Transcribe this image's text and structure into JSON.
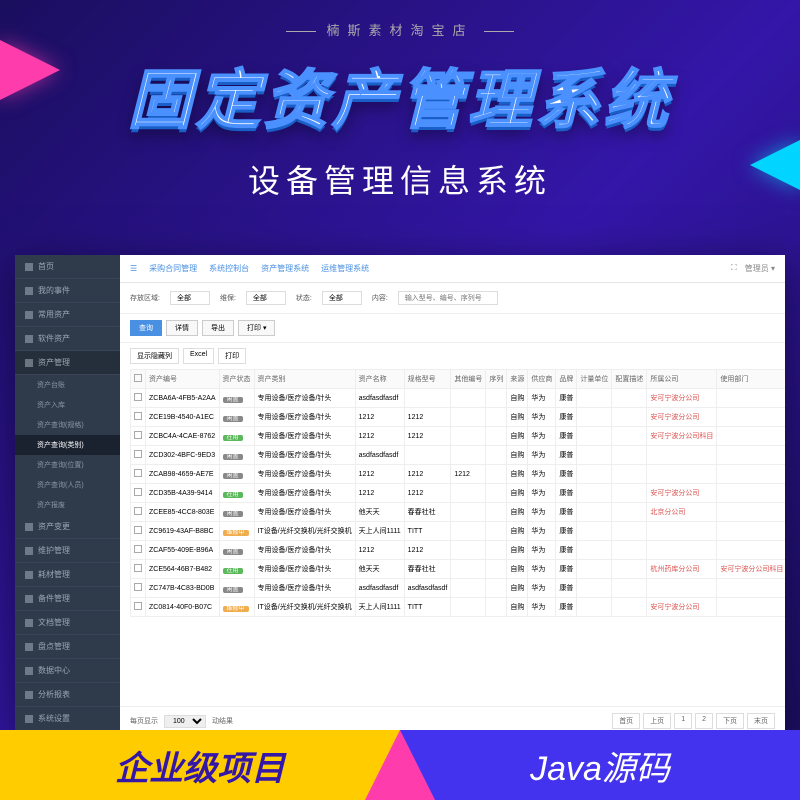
{
  "banner": {
    "tagline": "楠斯素材淘宝店",
    "title": "固定资产管理系统",
    "subtitle": "设备管理信息系统"
  },
  "footer": {
    "left": "企业级项目",
    "right": "Java源码"
  },
  "sidebar": {
    "items": [
      {
        "icon": "home",
        "label": "首页",
        "sub": []
      },
      {
        "icon": "user",
        "label": "我的事件",
        "sub": []
      },
      {
        "icon": "cube",
        "label": "常用资产",
        "sub": []
      },
      {
        "icon": "soft",
        "label": "软件资产",
        "sub": []
      },
      {
        "icon": "asset",
        "label": "资产管理",
        "expanded": true,
        "sub": [
          {
            "label": "资产台账"
          },
          {
            "label": "资产入库"
          },
          {
            "label": "资产查询(规格)"
          },
          {
            "label": "资产查询(类别)",
            "active": true
          },
          {
            "label": "资产查询(位置)"
          },
          {
            "label": "资产查询(人员)"
          },
          {
            "label": "资产报废"
          }
        ]
      },
      {
        "icon": "change",
        "label": "资产变更",
        "sub": []
      },
      {
        "icon": "maint",
        "label": "维护管理",
        "sub": []
      },
      {
        "icon": "mat",
        "label": "耗材管理",
        "sub": []
      },
      {
        "icon": "spare",
        "label": "备件管理",
        "sub": []
      },
      {
        "icon": "doc",
        "label": "文档管理",
        "sub": []
      },
      {
        "icon": "inv",
        "label": "盘点管理",
        "sub": []
      },
      {
        "icon": "data",
        "label": "数据中心",
        "sub": []
      },
      {
        "icon": "report",
        "label": "分析报表",
        "sub": []
      },
      {
        "icon": "sys",
        "label": "系统设置",
        "sub": []
      }
    ]
  },
  "topnav": {
    "items": [
      "采购合同管理",
      "系统控制台",
      "资产管理系统",
      "运维管理系统"
    ],
    "right": {
      "user": "管理员"
    }
  },
  "filters": {
    "area_label": "存放区域:",
    "area_value": "全部",
    "dept_label": "维保:",
    "dept_value": "全部",
    "status_label": "状态:",
    "status_value": "全部",
    "content_label": "内容:",
    "content_placeholder": "输入型号、编号、序列号"
  },
  "buttons": {
    "query": "查询",
    "detail": "详情",
    "export": "导出",
    "print": "打印 ▾"
  },
  "tools": {
    "cols": "显示隐藏列",
    "excel": "Excel",
    "tprint": "打印"
  },
  "table": {
    "headers": [
      "资产编号",
      "资产状态",
      "资产类别",
      "资产名称",
      "规格型号",
      "其他编号",
      "序列",
      "来源",
      "供应商",
      "品牌",
      "计量单位",
      "配置描述",
      "所属公司",
      "使用部门"
    ],
    "rows": [
      {
        "id": "ZCBA6A-4FB5-A2AA",
        "status": "闲置",
        "scls": "b-idle",
        "cat": "专用设备/医疗设备/针头",
        "name": "asdfasdfasdf",
        "spec": "",
        "other": "",
        "serial": "",
        "src": "自购",
        "sup": "华为",
        "brand": "康普",
        "unit": "",
        "conf": "",
        "comp": "安可宁波分公司",
        "dept": ""
      },
      {
        "id": "ZCE19B-4540-A1EC",
        "status": "闲置",
        "scls": "b-idle",
        "cat": "专用设备/医疗设备/针头",
        "name": "1212",
        "spec": "1212",
        "other": "",
        "serial": "",
        "src": "自购",
        "sup": "华为",
        "brand": "康普",
        "unit": "",
        "conf": "",
        "comp": "安可宁波分公司",
        "dept": ""
      },
      {
        "id": "ZCBC4A-4CAE-8762",
        "status": "在用",
        "scls": "b-use",
        "cat": "专用设备/医疗设备/针头",
        "name": "1212",
        "spec": "1212",
        "other": "",
        "serial": "",
        "src": "自购",
        "sup": "华为",
        "brand": "康普",
        "unit": "",
        "conf": "",
        "comp": "安可宁波分公司科目",
        "dept": ""
      },
      {
        "id": "ZCD302-4BFC-9ED3",
        "status": "闲置",
        "scls": "b-idle",
        "cat": "专用设备/医疗设备/针头",
        "name": "asdfasdfasdf",
        "spec": "",
        "other": "",
        "serial": "",
        "src": "自购",
        "sup": "华为",
        "brand": "康普",
        "unit": "",
        "conf": "",
        "comp": "",
        "dept": ""
      },
      {
        "id": "ZCAB98-4659-AE7E",
        "status": "闲置",
        "scls": "b-idle",
        "cat": "专用设备/医疗设备/针头",
        "name": "1212",
        "spec": "1212",
        "other": "1212",
        "serial": "",
        "src": "自购",
        "sup": "华为",
        "brand": "康普",
        "unit": "",
        "conf": "",
        "comp": "",
        "dept": ""
      },
      {
        "id": "ZCD35B-4A39-9414",
        "status": "在用",
        "scls": "b-use",
        "cat": "专用设备/医疗设备/针头",
        "name": "1212",
        "spec": "1212",
        "other": "",
        "serial": "",
        "src": "自购",
        "sup": "华为",
        "brand": "康普",
        "unit": "",
        "conf": "",
        "comp": "安可宁波分公司",
        "dept": ""
      },
      {
        "id": "ZCEE85-4CC8-803E",
        "status": "闲置",
        "scls": "b-idle",
        "cat": "专用设备/医疗设备/针头",
        "name": "他天天",
        "spec": "春春社社",
        "other": "",
        "serial": "",
        "src": "自购",
        "sup": "华为",
        "brand": "康普",
        "unit": "",
        "conf": "",
        "comp": "北京分公司",
        "dept": ""
      },
      {
        "id": "ZC9619-43AF-B8BC",
        "status": "维修中",
        "scls": "b-repair",
        "cat": "IT设备/光纤交换机/光纤交换机",
        "name": "天上人间1111",
        "spec": "TITT",
        "other": "",
        "serial": "",
        "src": "自购",
        "sup": "华为",
        "brand": "康普",
        "unit": "",
        "conf": "",
        "comp": "",
        "dept": ""
      },
      {
        "id": "ZCAF55-409E-B96A",
        "status": "闲置",
        "scls": "b-idle",
        "cat": "专用设备/医疗设备/针头",
        "name": "1212",
        "spec": "1212",
        "other": "",
        "serial": "",
        "src": "自购",
        "sup": "华为",
        "brand": "康普",
        "unit": "",
        "conf": "",
        "comp": "",
        "dept": ""
      },
      {
        "id": "ZCE564-46B7-B482",
        "status": "在用",
        "scls": "b-use",
        "cat": "专用设备/医疗设备/针头",
        "name": "他天天",
        "spec": "春春社社",
        "other": "",
        "serial": "",
        "src": "自购",
        "sup": "华为",
        "brand": "康普",
        "unit": "",
        "conf": "",
        "comp": "杭州药库分公司",
        "dept": "安可宁波分公司科目"
      },
      {
        "id": "ZC747B-4C83-BD0B",
        "status": "闲置",
        "scls": "b-idle",
        "cat": "专用设备/医疗设备/针头",
        "name": "asdfasdfasdf",
        "spec": "asdfasdfasdf",
        "other": "",
        "serial": "",
        "src": "自购",
        "sup": "华为",
        "brand": "康普",
        "unit": "",
        "conf": "",
        "comp": "",
        "dept": ""
      },
      {
        "id": "ZC0814-40F0-B07C",
        "status": "维修中",
        "scls": "b-repair",
        "cat": "IT设备/光纤交换机/光纤交换机",
        "name": "天上人间1111",
        "spec": "TITT",
        "other": "",
        "serial": "",
        "src": "自购",
        "sup": "华为",
        "brand": "康普",
        "unit": "",
        "conf": "",
        "comp": "安可宁波分公司",
        "dept": ""
      }
    ]
  },
  "pager": {
    "per_label": "每页显示",
    "per_value": "100",
    "total_label": "动结果",
    "first": "首页",
    "prev": "上页",
    "p1": "1",
    "p2": "2",
    "next": "下页",
    "last": "末页"
  }
}
